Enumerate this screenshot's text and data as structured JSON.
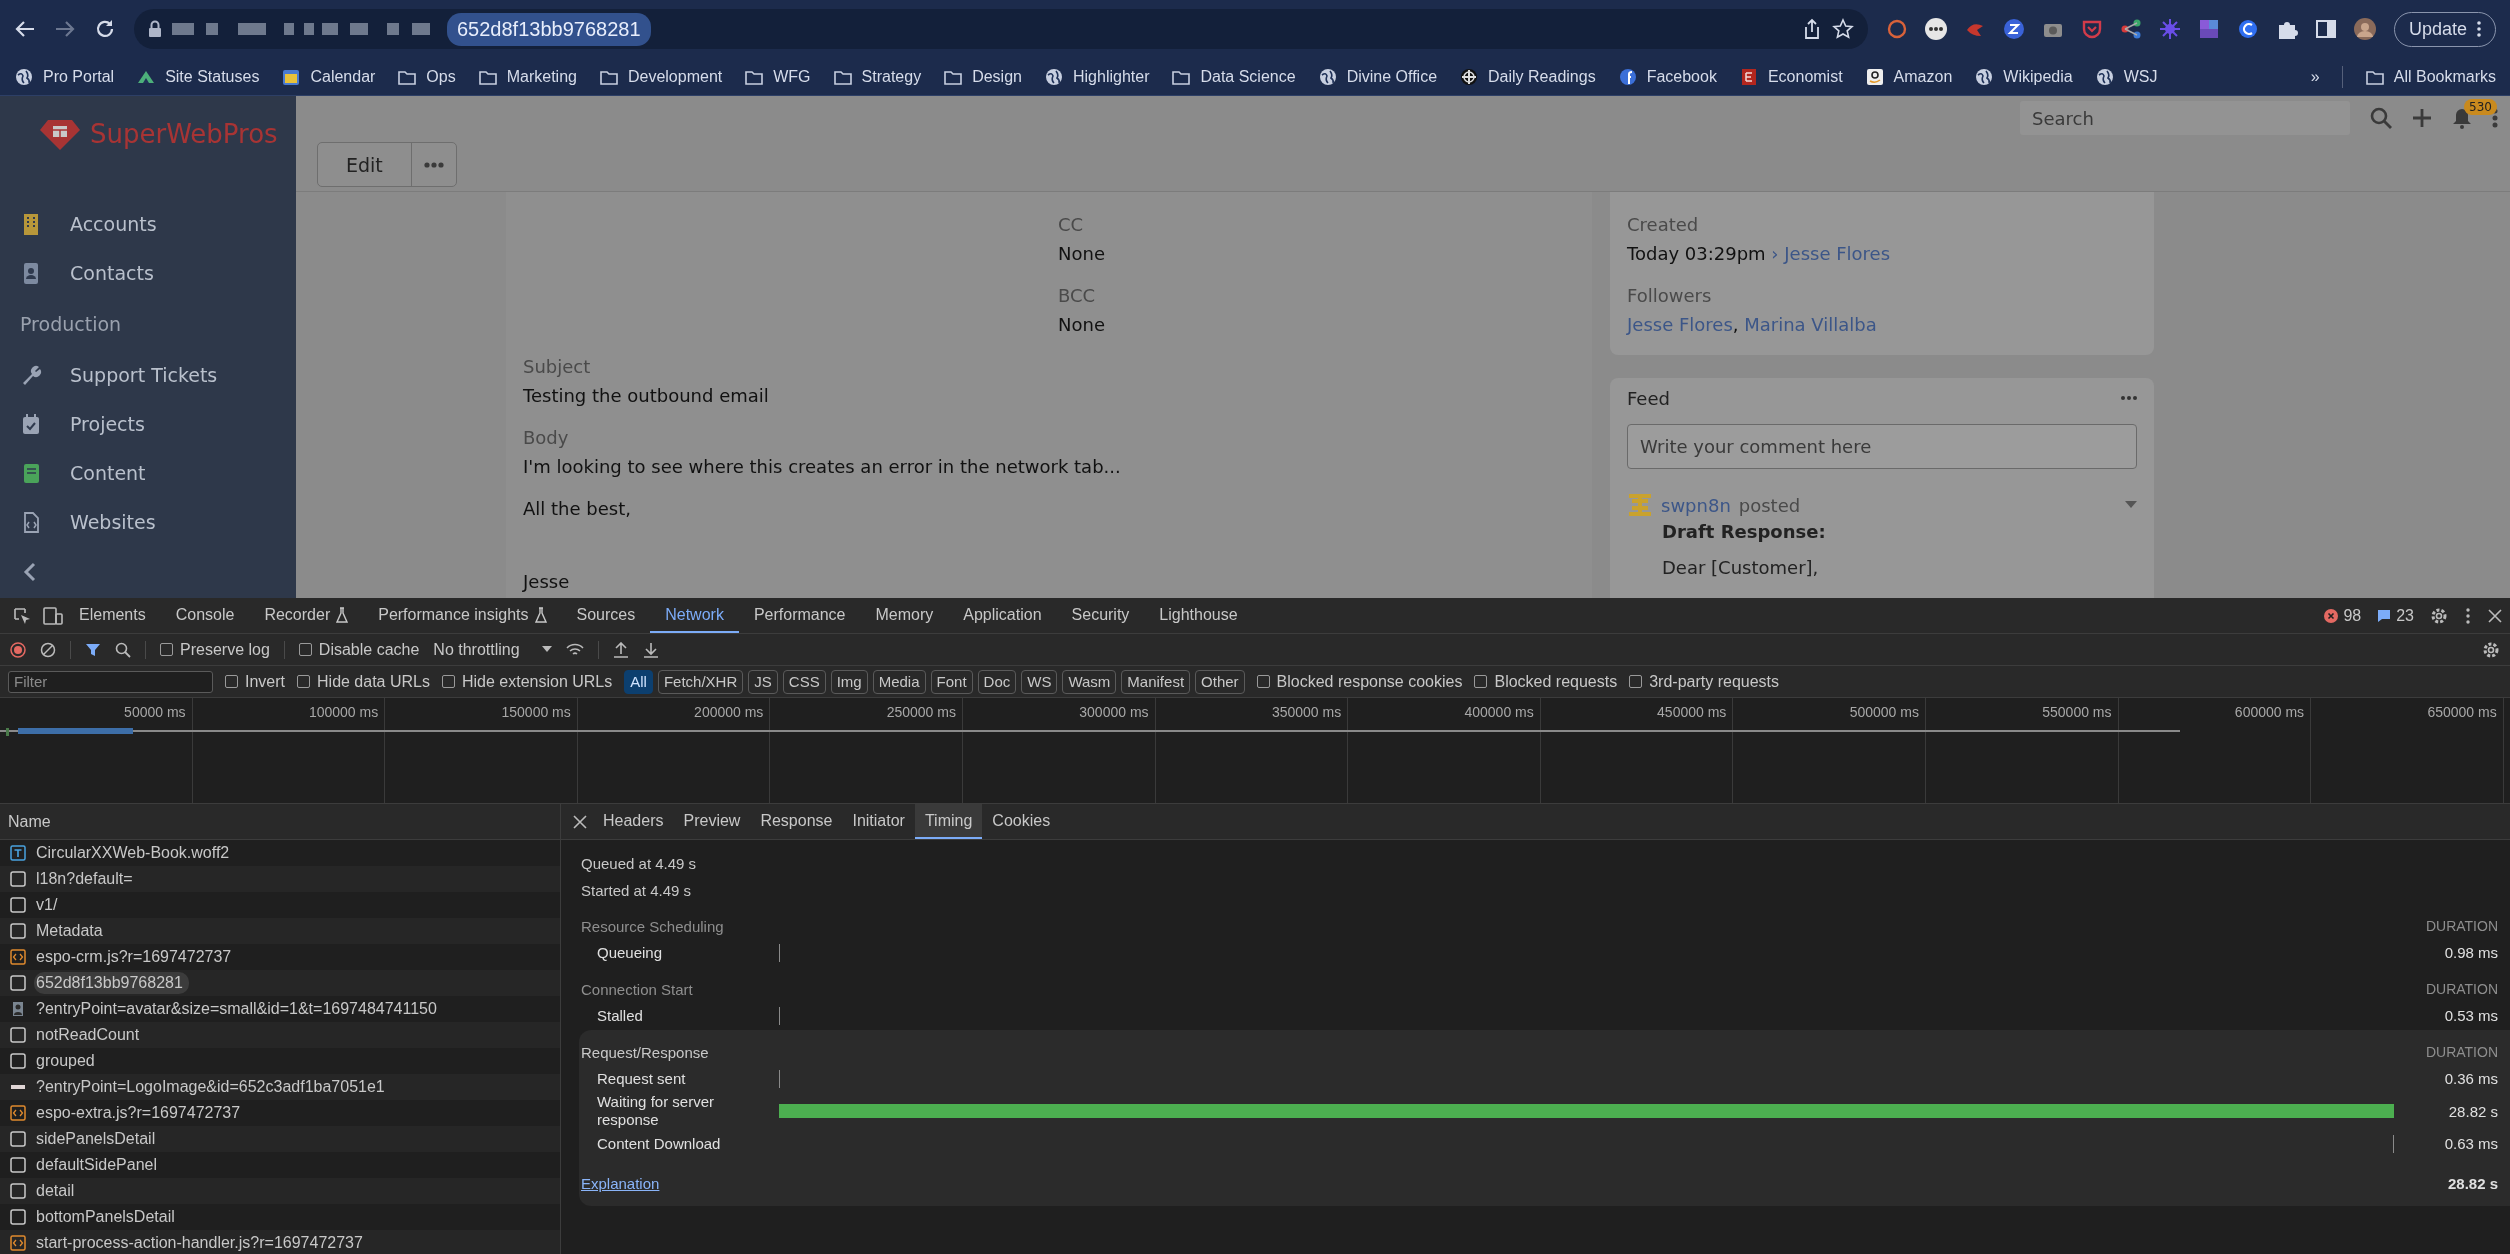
{
  "browser": {
    "url": "652d8f13bb9768281",
    "update_button": "Update",
    "bookmarks": [
      {
        "label": "Pro Portal",
        "kind": "globe"
      },
      {
        "label": "Site Statuses",
        "kind": "mountain"
      },
      {
        "label": "Calendar",
        "kind": "calendar"
      },
      {
        "label": "Ops",
        "kind": "folder"
      },
      {
        "label": "Marketing",
        "kind": "folder"
      },
      {
        "label": "Development",
        "kind": "folder"
      },
      {
        "label": "WFG",
        "kind": "folder"
      },
      {
        "label": "Strategy",
        "kind": "folder"
      },
      {
        "label": "Design",
        "kind": "folder"
      },
      {
        "label": "Highlighter",
        "kind": "globe"
      },
      {
        "label": "Data Science",
        "kind": "folder"
      },
      {
        "label": "Divine Office",
        "kind": "globe"
      },
      {
        "label": "Daily Readings",
        "kind": "crosshair"
      },
      {
        "label": "Facebook",
        "kind": "facebook"
      },
      {
        "label": "Economist",
        "kind": "redbox"
      },
      {
        "label": "Amazon",
        "kind": "amazon"
      },
      {
        "label": "Wikipedia",
        "kind": "globe"
      },
      {
        "label": "WSJ",
        "kind": "globe"
      }
    ],
    "more_bookmarks": "»",
    "all_bookmarks": "All Bookmarks"
  },
  "crm": {
    "logo": "SuperWebPros",
    "sidebar": [
      {
        "kind": "building",
        "label": "Accounts"
      },
      {
        "kind": "contact",
        "label": "Contacts"
      },
      {
        "kind": "heading",
        "label": "Production"
      },
      {
        "kind": "wrench",
        "label": "Support Tickets"
      },
      {
        "kind": "calendar-check",
        "label": "Projects"
      },
      {
        "kind": "book",
        "label": "Content"
      },
      {
        "kind": "file-code",
        "label": "Websites"
      }
    ],
    "search": {
      "placeholder": "Search"
    },
    "notification_count": "530",
    "edit_button": "Edit",
    "recipients": [
      {
        "label": "CC",
        "value": "None"
      },
      {
        "label": "BCC",
        "value": "None"
      }
    ],
    "subject": {
      "label": "Subject",
      "value": "Testing the outbound email"
    },
    "body": {
      "label": "Body",
      "lines": [
        "I'm looking to see where this creates an error in the network tab...",
        "All the best,",
        "Jesse"
      ]
    },
    "created": {
      "label": "Created",
      "value": "Today 03:29pm",
      "separator": "›",
      "user": "Jesse Flores"
    },
    "followers": {
      "label": "Followers",
      "names": [
        "Jesse Flores",
        "Marina Villalba"
      ],
      "separator": ","
    },
    "feed": {
      "title": "Feed",
      "placeholder": "Write your comment here",
      "post": {
        "user": "swpn8n",
        "action": "posted",
        "title": "Draft Response:",
        "text": "Dear [Customer],"
      }
    }
  },
  "devtools": {
    "tabs": [
      {
        "label": "Elements",
        "selected": false,
        "kind": "plain"
      },
      {
        "label": "Console",
        "selected": false,
        "kind": "plain"
      },
      {
        "label": "Recorder",
        "selected": false,
        "kind": "experiment"
      },
      {
        "label": "Performance insights",
        "selected": false,
        "kind": "experiment"
      },
      {
        "label": "Sources",
        "selected": false,
        "kind": "plain"
      },
      {
        "label": "Network",
        "selected": true,
        "kind": "plain"
      },
      {
        "label": "Performance",
        "selected": false,
        "kind": "plain"
      },
      {
        "label": "Memory",
        "selected": false,
        "kind": "plain"
      },
      {
        "label": "Application",
        "selected": false,
        "kind": "plain"
      },
      {
        "label": "Security",
        "selected": false,
        "kind": "plain"
      },
      {
        "label": "Lighthouse",
        "selected": false,
        "kind": "plain"
      }
    ],
    "errors": "98",
    "messages": "23",
    "preserve_log": {
      "label": "Preserve log",
      "checked": false
    },
    "disable_cache": {
      "label": "Disable cache",
      "checked": false
    },
    "throttling": "No throttling",
    "filter": {
      "placeholder": "Filter"
    },
    "filter_options": [
      {
        "label": "Invert",
        "checked": false
      },
      {
        "label": "Hide data URLs",
        "checked": false
      },
      {
        "label": "Hide extension URLs",
        "checked": false
      }
    ],
    "types": [
      {
        "label": "All",
        "selected": true
      },
      {
        "label": "Fetch/XHR",
        "selected": false
      },
      {
        "label": "JS",
        "selected": false
      },
      {
        "label": "CSS",
        "selected": false
      },
      {
        "label": "Img",
        "selected": false
      },
      {
        "label": "Media",
        "selected": false
      },
      {
        "label": "Font",
        "selected": false
      },
      {
        "label": "Doc",
        "selected": false
      },
      {
        "label": "WS",
        "selected": false
      },
      {
        "label": "Wasm",
        "selected": false
      },
      {
        "label": "Manifest",
        "selected": false
      },
      {
        "label": "Other",
        "selected": false
      }
    ],
    "blocked_options": [
      {
        "label": "Blocked response cookies",
        "checked": false
      },
      {
        "label": "Blocked requests",
        "checked": false
      },
      {
        "label": "3rd-party requests",
        "checked": false
      }
    ],
    "timeline_ticks": [
      "50000 ms",
      "100000 ms",
      "150000 ms",
      "200000 ms",
      "250000 ms",
      "300000 ms",
      "350000 ms",
      "400000 ms",
      "450000 ms",
      "500000 ms",
      "550000 ms",
      "600000 ms",
      "650000 ms"
    ],
    "name_heading": "Name",
    "requests": [
      {
        "name": "CircularXXWeb-Book.woff2",
        "kind": "font",
        "selected": false
      },
      {
        "name": "l18n?default=",
        "kind": "doc",
        "selected": false
      },
      {
        "name": "v1/",
        "kind": "doc",
        "selected": false
      },
      {
        "name": "Metadata",
        "kind": "doc",
        "selected": false
      },
      {
        "name": "espo-crm.js?r=1697472737",
        "kind": "script",
        "selected": false
      },
      {
        "name": "652d8f13bb9768281",
        "kind": "doc",
        "selected": true
      },
      {
        "name": "?entryPoint=avatar&size=small&id=1&t=1697484741150",
        "kind": "image",
        "selected": false
      },
      {
        "name": "notReadCount",
        "kind": "doc",
        "selected": false
      },
      {
        "name": "grouped",
        "kind": "doc",
        "selected": false
      },
      {
        "name": "?entryPoint=LogoImage&id=652c3adf1ba7051e1",
        "kind": "logo",
        "selected": false
      },
      {
        "name": "espo-extra.js?r=1697472737",
        "kind": "script",
        "selected": false
      },
      {
        "name": "sidePanelsDetail",
        "kind": "doc",
        "selected": false
      },
      {
        "name": "defaultSidePanel",
        "kind": "doc",
        "selected": false
      },
      {
        "name": "detail",
        "kind": "doc",
        "selected": false
      },
      {
        "name": "bottomPanelsDetail",
        "kind": "doc",
        "selected": false
      },
      {
        "name": "start-process-action-handler.js?r=1697472737",
        "kind": "script",
        "selected": false
      }
    ],
    "detail_tabs": [
      {
        "label": "Headers",
        "selected": false
      },
      {
        "label": "Preview",
        "selected": false
      },
      {
        "label": "Response",
        "selected": false
      },
      {
        "label": "Initiator",
        "selected": false
      },
      {
        "label": "Timing",
        "selected": true
      },
      {
        "label": "Cookies",
        "selected": false
      }
    ],
    "timing": {
      "queued": "Queued at 4.49 s",
      "started": "Started at 4.49 s",
      "sections": [
        {
          "title": "Resource Scheduling",
          "duration_heading": "DURATION",
          "rows": [
            {
              "label": "Queueing",
              "kind": "tick-start",
              "value": "0.98 ms"
            }
          ]
        },
        {
          "title": "Connection Start",
          "duration_heading": "DURATION",
          "rows": [
            {
              "label": "Stalled",
              "kind": "tick-start",
              "value": "0.53 ms"
            }
          ]
        },
        {
          "title": "Request/Response",
          "duration_heading": "DURATION",
          "rows": [
            {
              "label": "Request sent",
              "kind": "tick-start",
              "value": "0.36 ms"
            },
            {
              "label": "Waiting for server response",
              "kind": "bar",
              "value": "28.82 s"
            },
            {
              "label": "Content Download",
              "kind": "tick-end",
              "value": "0.63 ms"
            }
          ]
        }
      ],
      "explanation": "Explanation",
      "total": "28.82 s"
    }
  }
}
